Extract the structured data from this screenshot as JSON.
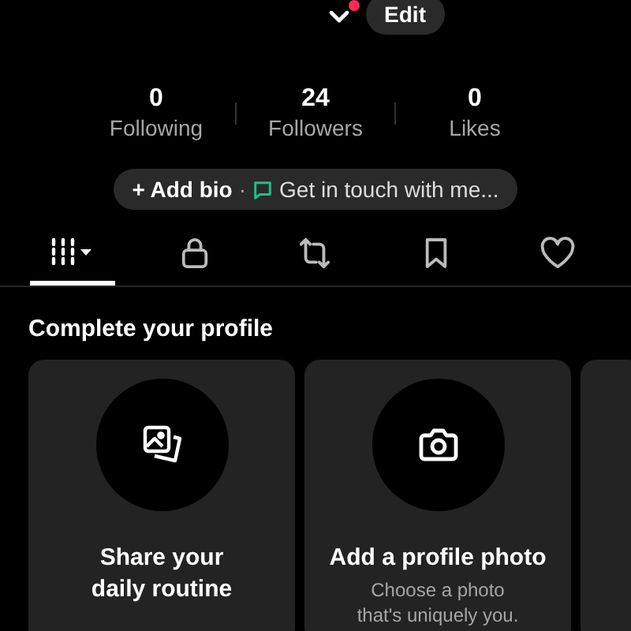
{
  "header": {
    "has_notification": true,
    "edit_button": "Edit"
  },
  "stats": [
    {
      "value": "0",
      "label": "Following"
    },
    {
      "value": "24",
      "label": "Followers"
    },
    {
      "value": "0",
      "label": "Likes"
    }
  ],
  "bio_bar": {
    "add_bio": "+ Add bio",
    "separator": "·",
    "contact": "Get in touch with me..."
  },
  "tabs": [
    {
      "kind": "grid",
      "selected": true
    },
    {
      "kind": "lock",
      "selected": false
    },
    {
      "kind": "repost",
      "selected": false
    },
    {
      "kind": "bookmark",
      "selected": false
    },
    {
      "kind": "heart",
      "selected": false
    }
  ],
  "section_title": "Complete your profile",
  "cards": [
    {
      "kind": "photos",
      "title": "Share your daily routine"
    },
    {
      "kind": "camera",
      "title": "Add a profile photo",
      "subtitle": "Choose a photo that's uniquely you."
    },
    {
      "kind": "partial"
    }
  ]
}
